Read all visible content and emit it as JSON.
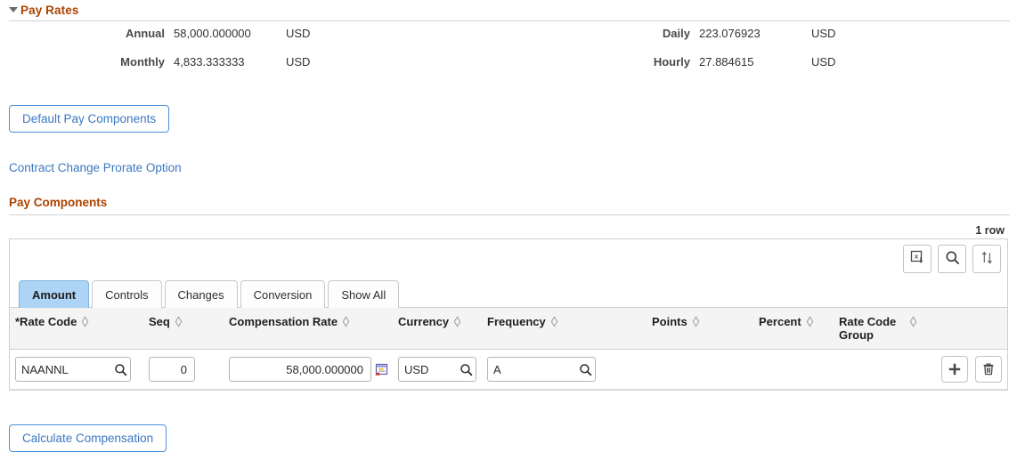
{
  "pay_rates": {
    "title": "Pay Rates",
    "collapse_icon": "caret-down-icon",
    "rows": [
      {
        "left": {
          "label": "Annual",
          "value": "58,000.000000",
          "currency": "USD"
        },
        "right": {
          "label": "Daily",
          "value": "223.076923",
          "currency": "USD"
        }
      },
      {
        "left": {
          "label": "Monthly",
          "value": "4,833.333333",
          "currency": "USD"
        },
        "right": {
          "label": "Hourly",
          "value": "27.884615",
          "currency": "USD"
        }
      }
    ]
  },
  "actions": {
    "default_pay_components": "Default Pay Components",
    "contract_change_prorate_option": "Contract Change Prorate Option",
    "calculate_compensation": "Calculate Compensation"
  },
  "pay_components": {
    "title": "Pay Components",
    "row_count": "1 row",
    "toolbar": [
      {
        "name": "download-to-excel-icon",
        "title": "Download to Excel"
      },
      {
        "name": "find-icon",
        "title": "Find"
      },
      {
        "name": "sort-icon",
        "title": "Sort"
      }
    ],
    "tabs": [
      {
        "label": "Amount",
        "active": true
      },
      {
        "label": "Controls",
        "active": false
      },
      {
        "label": "Changes",
        "active": false
      },
      {
        "label": "Conversion",
        "active": false
      },
      {
        "label": "Show All",
        "active": false
      }
    ],
    "columns": [
      {
        "label": "*Rate Code",
        "sortable": true,
        "align": "left"
      },
      {
        "label": "Seq",
        "sortable": true,
        "align": "left"
      },
      {
        "label": "Compensation Rate",
        "sortable": true,
        "align": "right"
      },
      {
        "label": "Currency",
        "sortable": true,
        "align": "left"
      },
      {
        "label": "Frequency",
        "sortable": true,
        "align": "left"
      },
      {
        "label": "Points",
        "sortable": true,
        "align": "left"
      },
      {
        "label": "Percent",
        "sortable": true,
        "align": "left"
      },
      {
        "label": "Rate Code Group",
        "sortable": true,
        "align": "left"
      },
      {
        "label": "",
        "sortable": false,
        "align": "right"
      }
    ],
    "rows": [
      {
        "rate_code": "NAANNL",
        "seq": "0",
        "compensation_rate": "58,000.000000",
        "currency": "USD",
        "frequency": "A",
        "points": "",
        "percent": "",
        "rate_code_group": "",
        "add_label": "+",
        "delete_label": "Delete row"
      }
    ]
  },
  "colors": {
    "section_title": "#ab4300",
    "link": "#3a78c2",
    "tab_active_bg": "#aed4f5",
    "header_bg": "#f4f4f4"
  }
}
